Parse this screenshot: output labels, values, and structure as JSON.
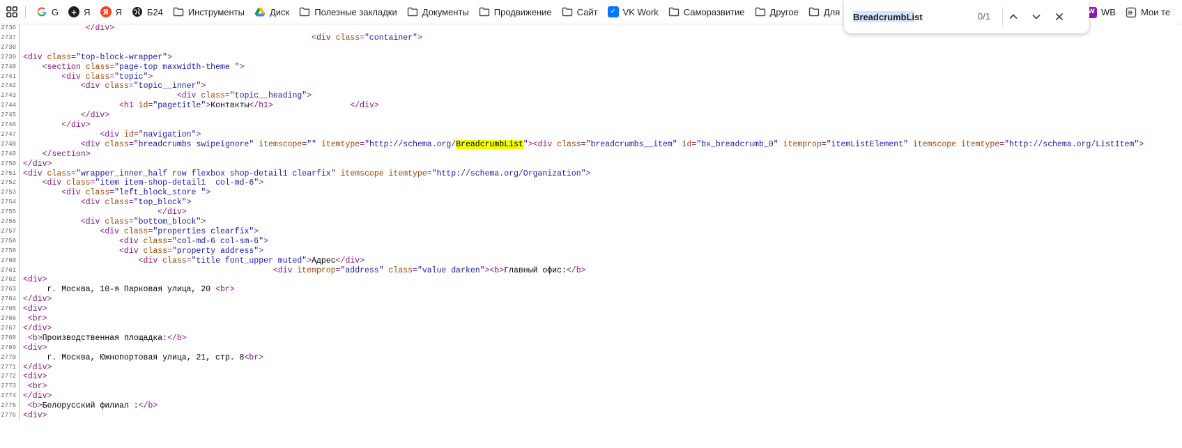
{
  "bookmarks": [
    {
      "id": "google",
      "label": "G",
      "icon": "google-icon",
      "color": "#4285f4"
    },
    {
      "id": "yandex-plus",
      "label": "Я",
      "icon": "plus-icon",
      "color": "#1f1f1f"
    },
    {
      "id": "yandex",
      "label": "Я",
      "icon": "yandex-icon",
      "color": "#fc3f1d"
    },
    {
      "id": "b24",
      "label": "Б24",
      "icon": "globe-icon",
      "color": "#1f1f1f"
    },
    {
      "id": "tools",
      "label": "Инструменты",
      "icon": "folder-icon"
    },
    {
      "id": "disk",
      "label": "Диск",
      "icon": "drive-icon"
    },
    {
      "id": "useful",
      "label": "Полезные закладки",
      "icon": "folder-icon"
    },
    {
      "id": "docs",
      "label": "Документы",
      "icon": "folder-icon"
    },
    {
      "id": "promo",
      "label": "Продвижение",
      "icon": "folder-icon"
    },
    {
      "id": "site",
      "label": "Сайт",
      "icon": "folder-icon"
    },
    {
      "id": "vkwork",
      "label": "VK Work",
      "icon": "vk-icon",
      "color": "#0077ff"
    },
    {
      "id": "selfdev",
      "label": "Саморазвитие",
      "icon": "folder-icon"
    },
    {
      "id": "other",
      "label": "Другое",
      "icon": "folder-icon"
    },
    {
      "id": "for",
      "label": "Для",
      "icon": "folder-icon"
    }
  ],
  "right_bookmarks": [
    {
      "id": "wb",
      "label": "WB",
      "icon": "wb-icon",
      "color": "#8c1bab"
    },
    {
      "id": "mine",
      "label": "Мои те",
      "icon": "bookmark-square-icon"
    }
  ],
  "find": {
    "query": "BreadcrumbList",
    "count": "0/1"
  },
  "source": {
    "lines": [
      {
        "n": "2736",
        "i": 13,
        "tk": [
          [
            "t",
            "</div>"
          ]
        ]
      },
      {
        "n": "2737",
        "i": 60,
        "tk": [
          [
            "t",
            "<div "
          ],
          [
            "a",
            "class"
          ],
          [
            "t",
            "="
          ],
          [
            "v",
            "\"container\""
          ],
          [
            "t",
            ">"
          ]
        ]
      },
      {
        "n": "2738",
        "i": 0,
        "tk": []
      },
      {
        "n": "2739",
        "i": 0,
        "tk": [
          [
            "t",
            "<div "
          ],
          [
            "a",
            "class"
          ],
          [
            "t",
            "="
          ],
          [
            "v",
            "\"top-block-wrapper\""
          ],
          [
            "t",
            ">"
          ]
        ]
      },
      {
        "n": "2740",
        "i": 4,
        "tk": [
          [
            "t",
            "<section "
          ],
          [
            "a",
            "class"
          ],
          [
            "t",
            "="
          ],
          [
            "v",
            "\"page-top maxwidth-theme \""
          ],
          [
            "t",
            ">"
          ]
        ]
      },
      {
        "n": "2741",
        "i": 8,
        "tk": [
          [
            "t",
            "<div "
          ],
          [
            "a",
            "class"
          ],
          [
            "t",
            "="
          ],
          [
            "v",
            "\"topic\""
          ],
          [
            "t",
            ">"
          ]
        ]
      },
      {
        "n": "2742",
        "i": 12,
        "tk": [
          [
            "t",
            "<div "
          ],
          [
            "a",
            "class"
          ],
          [
            "t",
            "="
          ],
          [
            "v",
            "\"topic__inner\""
          ],
          [
            "t",
            ">"
          ]
        ]
      },
      {
        "n": "2743",
        "i": 32,
        "tk": [
          [
            "t",
            "<div "
          ],
          [
            "a",
            "class"
          ],
          [
            "t",
            "="
          ],
          [
            "v",
            "\"topic__heading\""
          ],
          [
            "t",
            ">"
          ]
        ]
      },
      {
        "n": "2744",
        "i": 20,
        "tk": [
          [
            "t",
            "<h1 "
          ],
          [
            "a",
            "id"
          ],
          [
            "t",
            "="
          ],
          [
            "v",
            "\"pagetitle\""
          ],
          [
            "t",
            ">"
          ],
          [
            "x",
            "Контакты"
          ],
          [
            "t",
            "</h1>"
          ],
          [
            "x",
            "                "
          ],
          [
            "t",
            "</div>"
          ]
        ]
      },
      {
        "n": "2745",
        "i": 12,
        "tk": [
          [
            "t",
            "</div>"
          ]
        ]
      },
      {
        "n": "2746",
        "i": 8,
        "tk": [
          [
            "t",
            "</div>"
          ]
        ]
      },
      {
        "n": "2747",
        "i": 16,
        "tk": [
          [
            "t",
            "<div "
          ],
          [
            "a",
            "id"
          ],
          [
            "t",
            "="
          ],
          [
            "v",
            "\"navigation\""
          ],
          [
            "t",
            ">"
          ]
        ]
      },
      {
        "n": "2748",
        "i": 12,
        "tk": [
          [
            "t",
            "<div "
          ],
          [
            "a",
            "class"
          ],
          [
            "t",
            "="
          ],
          [
            "v",
            "\"breadcrumbs swipeignore\""
          ],
          [
            "x",
            " "
          ],
          [
            "a",
            "itemscope"
          ],
          [
            "t",
            "="
          ],
          [
            "v",
            "\"\""
          ],
          [
            "x",
            " "
          ],
          [
            "a",
            "itemtype"
          ],
          [
            "t",
            "="
          ],
          [
            "v",
            "\"http://schema.org/"
          ],
          [
            "h",
            "BreadcrumbList"
          ],
          [
            "v",
            "\""
          ],
          [
            "t",
            "><div "
          ],
          [
            "a",
            "class"
          ],
          [
            "t",
            "="
          ],
          [
            "v",
            "\"breadcrumbs__item\""
          ],
          [
            "x",
            " "
          ],
          [
            "a",
            "id"
          ],
          [
            "t",
            "="
          ],
          [
            "v",
            "\"bx_breadcrumb_0\""
          ],
          [
            "x",
            " "
          ],
          [
            "a",
            "itemprop"
          ],
          [
            "t",
            "="
          ],
          [
            "v",
            "\"itemListElement\""
          ],
          [
            "x",
            " "
          ],
          [
            "a",
            "itemscope"
          ],
          [
            "x",
            " "
          ],
          [
            "a",
            "itemtype"
          ],
          [
            "t",
            "="
          ],
          [
            "v",
            "\"http://schema.org/ListItem\""
          ],
          [
            "t",
            ">"
          ]
        ]
      },
      {
        "n": "2749",
        "i": 4,
        "tk": [
          [
            "t",
            "</section>"
          ]
        ]
      },
      {
        "n": "2750",
        "i": 0,
        "tk": [
          [
            "t",
            "</div>"
          ]
        ]
      },
      {
        "n": "2751",
        "i": 0,
        "tk": [
          [
            "t",
            "<div "
          ],
          [
            "a",
            "class"
          ],
          [
            "t",
            "="
          ],
          [
            "v",
            "\"wrapper_inner_half row flexbox shop-detail1 clearfix\""
          ],
          [
            "x",
            " "
          ],
          [
            "a",
            "itemscope"
          ],
          [
            "x",
            " "
          ],
          [
            "a",
            "itemtype"
          ],
          [
            "t",
            "="
          ],
          [
            "v",
            "\"http://schema.org/Organization\""
          ],
          [
            "t",
            ">"
          ]
        ]
      },
      {
        "n": "2752",
        "i": 4,
        "tk": [
          [
            "t",
            "<div "
          ],
          [
            "a",
            "class"
          ],
          [
            "t",
            "="
          ],
          [
            "v",
            "\"item item-shop-detail1  col-md-6\""
          ],
          [
            "t",
            ">"
          ]
        ]
      },
      {
        "n": "2753",
        "i": 8,
        "tk": [
          [
            "t",
            "<div "
          ],
          [
            "a",
            "class"
          ],
          [
            "t",
            "="
          ],
          [
            "v",
            "\"left_block_store \""
          ],
          [
            "t",
            ">"
          ]
        ]
      },
      {
        "n": "2754",
        "i": 12,
        "tk": [
          [
            "t",
            "<div "
          ],
          [
            "a",
            "class"
          ],
          [
            "t",
            "="
          ],
          [
            "v",
            "\"top_block\""
          ],
          [
            "t",
            ">"
          ]
        ]
      },
      {
        "n": "2755",
        "i": 28,
        "tk": [
          [
            "t",
            "</div>"
          ]
        ]
      },
      {
        "n": "2756",
        "i": 12,
        "tk": [
          [
            "t",
            "<div "
          ],
          [
            "a",
            "class"
          ],
          [
            "t",
            "="
          ],
          [
            "v",
            "\"bottom_block\""
          ],
          [
            "t",
            ">"
          ]
        ]
      },
      {
        "n": "2757",
        "i": 16,
        "tk": [
          [
            "t",
            "<div "
          ],
          [
            "a",
            "class"
          ],
          [
            "t",
            "="
          ],
          [
            "v",
            "\"properties clearfix\""
          ],
          [
            "t",
            ">"
          ]
        ]
      },
      {
        "n": "2758",
        "i": 20,
        "tk": [
          [
            "t",
            "<div "
          ],
          [
            "a",
            "class"
          ],
          [
            "t",
            "="
          ],
          [
            "v",
            "\"col-md-6 col-sm-6\""
          ],
          [
            "t",
            ">"
          ]
        ]
      },
      {
        "n": "2759",
        "i": 20,
        "tk": [
          [
            "t",
            "<div "
          ],
          [
            "a",
            "class"
          ],
          [
            "t",
            "="
          ],
          [
            "v",
            "\"property address\""
          ],
          [
            "t",
            ">"
          ]
        ]
      },
      {
        "n": "2760",
        "i": 24,
        "tk": [
          [
            "t",
            "<div "
          ],
          [
            "a",
            "class"
          ],
          [
            "t",
            "="
          ],
          [
            "v",
            "\"title font_upper muted\""
          ],
          [
            "t",
            ">"
          ],
          [
            "x",
            "Адрес"
          ],
          [
            "t",
            "</div>"
          ]
        ]
      },
      {
        "n": "2761",
        "i": 52,
        "tk": [
          [
            "t",
            "<div "
          ],
          [
            "a",
            "itemprop"
          ],
          [
            "t",
            "="
          ],
          [
            "v",
            "\"address\""
          ],
          [
            "x",
            " "
          ],
          [
            "a",
            "class"
          ],
          [
            "t",
            "="
          ],
          [
            "v",
            "\"value darken\""
          ],
          [
            "t",
            "><b>"
          ],
          [
            "x",
            "Главный офис:"
          ],
          [
            "t",
            "</b>"
          ]
        ]
      },
      {
        "n": "2762",
        "i": 0,
        "tk": [
          [
            "t",
            "<div>"
          ]
        ]
      },
      {
        "n": "2763",
        "i": 5,
        "tk": [
          [
            "x",
            "г. Москва, 10-я Парковая улица, 20 "
          ],
          [
            "t",
            "<br>"
          ]
        ]
      },
      {
        "n": "2764",
        "i": 0,
        "tk": [
          [
            "t",
            "</div>"
          ]
        ]
      },
      {
        "n": "2765",
        "i": 0,
        "tk": [
          [
            "t",
            "<div>"
          ]
        ]
      },
      {
        "n": "2766",
        "i": 1,
        "tk": [
          [
            "t",
            "<br>"
          ]
        ]
      },
      {
        "n": "2767",
        "i": 0,
        "tk": [
          [
            "t",
            "</div>"
          ]
        ]
      },
      {
        "n": "2768",
        "i": 1,
        "tk": [
          [
            "t",
            "<b>"
          ],
          [
            "x",
            "Производственная площадка:"
          ],
          [
            "t",
            "</b>"
          ]
        ]
      },
      {
        "n": "2769",
        "i": 0,
        "tk": [
          [
            "t",
            "<div>"
          ]
        ]
      },
      {
        "n": "2770",
        "i": 5,
        "tk": [
          [
            "x",
            "г. Москва, Южнопортовая улица, 21, стр. 8"
          ],
          [
            "t",
            "<br>"
          ]
        ]
      },
      {
        "n": "2771",
        "i": 0,
        "tk": [
          [
            "t",
            "</div>"
          ]
        ]
      },
      {
        "n": "2772",
        "i": 0,
        "tk": [
          [
            "t",
            "<div>"
          ]
        ]
      },
      {
        "n": "2773",
        "i": 1,
        "tk": [
          [
            "t",
            "<br>"
          ]
        ]
      },
      {
        "n": "2774",
        "i": 0,
        "tk": [
          [
            "t",
            "</div>"
          ]
        ]
      },
      {
        "n": "2775",
        "i": 1,
        "tk": [
          [
            "t",
            "<b>"
          ],
          [
            "x",
            "Белорусский филиал :"
          ],
          [
            "t",
            "</b>"
          ]
        ]
      },
      {
        "n": "2776",
        "i": 0,
        "tk": [
          [
            "t",
            "<div>"
          ]
        ]
      }
    ]
  }
}
